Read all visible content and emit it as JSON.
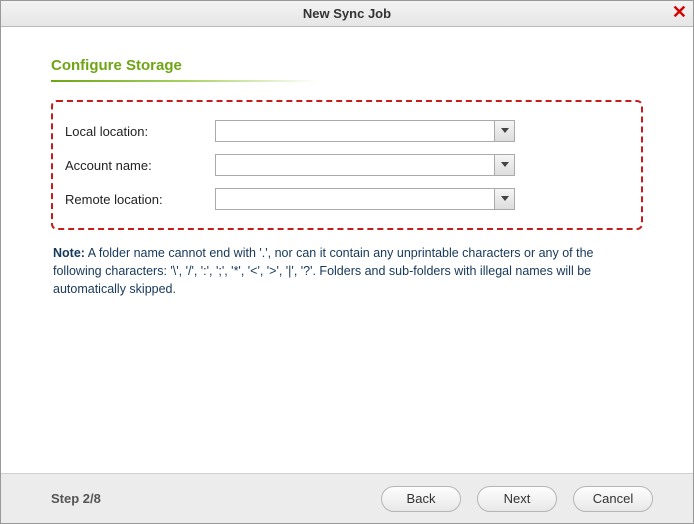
{
  "title": "New Sync Job",
  "sectionTitle": "Configure Storage",
  "fields": {
    "localLocation": {
      "label": "Local location:",
      "value": ""
    },
    "accountName": {
      "label": "Account name:",
      "value": ""
    },
    "remoteLocation": {
      "label": "Remote location:",
      "value": ""
    }
  },
  "note": {
    "prefix": "Note:",
    "body": " A folder name cannot end with '.', nor can it contain any unprintable characters or any of the following characters: '\\', '/', ':', ';', '*', '<', '>', '|', '?'. Folders and sub-folders with illegal names will be automatically skipped."
  },
  "footer": {
    "step": "Step 2/8",
    "back": "Back",
    "next": "Next",
    "cancel": "Cancel"
  }
}
